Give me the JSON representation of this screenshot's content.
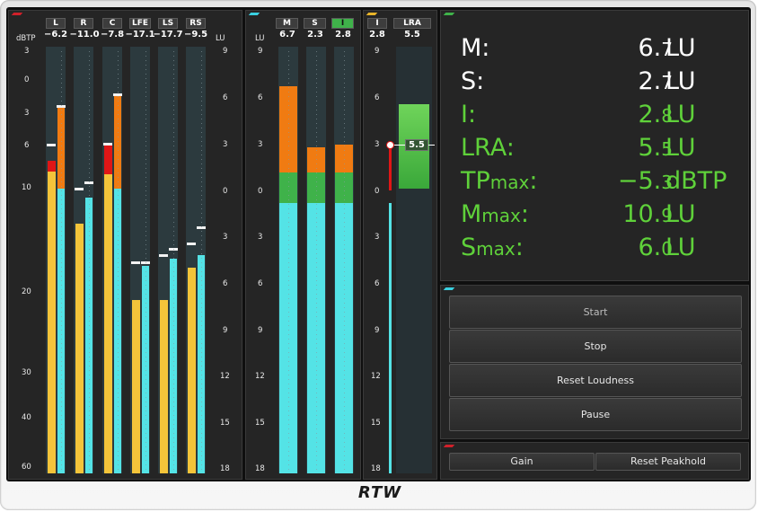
{
  "meter_panel": {
    "unit_left": "dBTP",
    "unit_right": "LU",
    "channels": [
      {
        "label": "L",
        "value": "−6.2"
      },
      {
        "label": "R",
        "value": "−11.0"
      },
      {
        "label": "C",
        "value": "−7.8"
      },
      {
        "label": "LFE",
        "value": "−17.1"
      },
      {
        "label": "LS",
        "value": "−17.7"
      },
      {
        "label": "RS",
        "value": "−9.5"
      }
    ],
    "dbtp_scale": [
      "3",
      "0",
      "3",
      "6",
      "10",
      "20",
      "30",
      "40",
      "60"
    ],
    "lu_scale": [
      "9",
      "6",
      "3",
      "0",
      "3",
      "6",
      "9",
      "12",
      "15",
      "18"
    ]
  },
  "loudness_panel": {
    "unit": "LU",
    "channels": [
      {
        "label": "M",
        "value": "6.7"
      },
      {
        "label": "S",
        "value": "2.3"
      },
      {
        "label": "I",
        "value": "2.8"
      }
    ],
    "scale": [
      "9",
      "6",
      "3",
      "0",
      "3",
      "6",
      "9",
      "12",
      "15",
      "18"
    ]
  },
  "lra_panel": {
    "channels": [
      {
        "label": "I",
        "value": "2.8"
      },
      {
        "label": "LRA",
        "value": "5.5"
      }
    ],
    "scale": [
      "9",
      "6",
      "3",
      "0",
      "3",
      "6",
      "9",
      "12",
      "15",
      "18"
    ],
    "marker_value": "5.5"
  },
  "readout": {
    "rows": [
      {
        "name": "M:",
        "value": "6.",
        "decimal": "7",
        "unit": "LU",
        "color": "#ffffff"
      },
      {
        "name": "S:",
        "value": "2.",
        "decimal": "7",
        "unit": "LU",
        "color": "#ffffff"
      },
      {
        "name": "I:",
        "value": "2.",
        "decimal": "8",
        "unit": "LU",
        "color": "#5fd13a"
      },
      {
        "name": "LRA:",
        "value": "5.",
        "decimal": "5",
        "unit": "LU",
        "color": "#5fd13a"
      },
      {
        "name": "TP",
        "name_sub": "max",
        "name_end": ":",
        "value": "−5.",
        "decimal": "3",
        "unit": "dBTP",
        "color": "#5fd13a"
      },
      {
        "name": "M",
        "name_sub": "max",
        "name_end": ":",
        "value": "10.",
        "decimal": "9",
        "unit": "LU",
        "color": "#5fd13a"
      },
      {
        "name": "S",
        "name_sub": "max",
        "name_end": ":",
        "value": "6.",
        "decimal": "0",
        "unit": "LU",
        "color": "#5fd13a"
      }
    ]
  },
  "controls": {
    "start": "Start",
    "stop": "Stop",
    "reset_loudness": "Reset Loudness",
    "pause": "Pause",
    "gain": "Gain",
    "reset_peakhold": "Reset Peakhold"
  },
  "brand": {
    "logo": "RTW"
  },
  "colors": {
    "peak_yellow": "#f4c43a",
    "rms_cyan": "#54e3e6",
    "overload_red": "#e01616",
    "loudness_orange": "#f07b12",
    "target_green": "#3fb24a",
    "readout_green": "#5fd13a"
  }
}
